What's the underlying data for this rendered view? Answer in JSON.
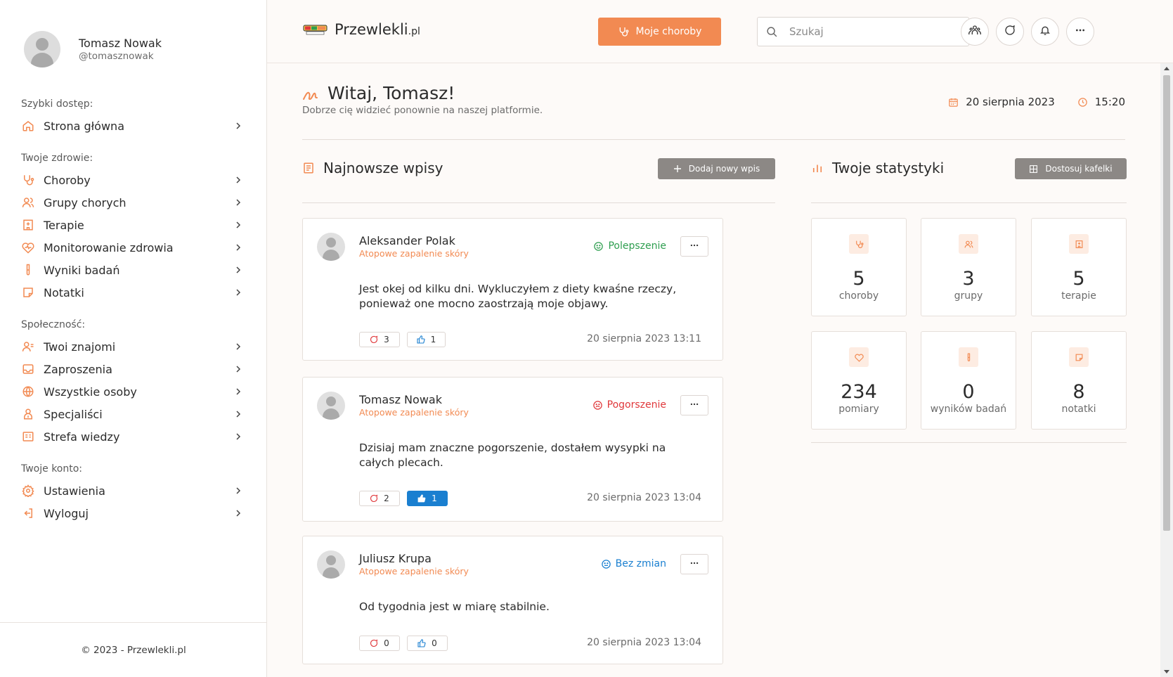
{
  "user": {
    "name": "Tomasz Nowak",
    "handle": "@tomasznowak"
  },
  "sidebar": {
    "quick_heading": "Szybki dostęp:",
    "quick": [
      {
        "label": "Strona główna",
        "icon": "home-icon"
      }
    ],
    "health_heading": "Twoje zdrowie:",
    "health": [
      {
        "label": "Choroby",
        "icon": "stethoscope-icon"
      },
      {
        "label": "Grupy chorych",
        "icon": "users-icon"
      },
      {
        "label": "Terapie",
        "icon": "hospital-icon"
      },
      {
        "label": "Monitorowanie zdrowia",
        "icon": "heart-pulse-icon"
      },
      {
        "label": "Wyniki badań",
        "icon": "test-tube-icon"
      },
      {
        "label": "Notatki",
        "icon": "note-icon"
      }
    ],
    "community_heading": "Społeczność:",
    "community": [
      {
        "label": "Twoi znajomi",
        "icon": "friends-icon"
      },
      {
        "label": "Zaproszenia",
        "icon": "inbox-icon"
      },
      {
        "label": "Wszystkie osoby",
        "icon": "globe-icon"
      },
      {
        "label": "Specjaliści",
        "icon": "specialist-icon"
      },
      {
        "label": "Strefa wiedzy",
        "icon": "knowledge-icon"
      }
    ],
    "account_heading": "Twoje konto:",
    "account": [
      {
        "label": "Ustawienia",
        "icon": "settings-icon"
      },
      {
        "label": "Wyloguj",
        "icon": "logout-icon"
      }
    ],
    "footer": "© 2023 - Przewlekli.pl"
  },
  "topbar": {
    "logo_main": "Przewlekli",
    "logo_suffix": ".pl",
    "primary_button": "Moje choroby",
    "search_placeholder": "Szukaj"
  },
  "welcome": {
    "title": "Witaj, Tomasz!",
    "subtitle": "Dobrze cię widzieć ponownie na naszej platformie.",
    "date": "20 sierpnia 2023",
    "time": "15:20"
  },
  "posts_section": {
    "title": "Najnowsze wpisy",
    "add_button": "Dodaj nowy wpis"
  },
  "stats_section": {
    "title": "Twoje statystyki",
    "customize_button": "Dostosuj kafelki"
  },
  "posts": [
    {
      "author": "Aleksander Polak",
      "condition": "Atopowe zapalenie skóry",
      "status": "Polepszenie",
      "status_color": "#2e9e4f",
      "text": "Jest okej od kilku dni. Wykluczyłem z diety kwaśne rzeczy, ponieważ one mocno zaostrzają moje objawy.",
      "comments": "3",
      "likes": "1",
      "liked": false,
      "date": "20 sierpnia 2023 13:11"
    },
    {
      "author": "Tomasz Nowak",
      "condition": "Atopowe zapalenie skóry",
      "status": "Pogorszenie",
      "status_color": "#e0383b",
      "text": "Dzisiaj mam znaczne pogorszenie, dostałem wysypki na całych plecach.",
      "comments": "2",
      "likes": "1",
      "liked": true,
      "date": "20 sierpnia 2023 13:04"
    },
    {
      "author": "Juliusz Krupa",
      "condition": "Atopowe zapalenie skóry",
      "status": "Bez zmian",
      "status_color": "#1a7fd0",
      "text": "Od tygodnia jest w miarę stabilnie.",
      "comments": "0",
      "likes": "0",
      "liked": false,
      "date": "20 sierpnia 2023 13:04"
    }
  ],
  "stats": [
    {
      "value": "5",
      "label": "choroby",
      "icon": "stethoscope-icon"
    },
    {
      "value": "3",
      "label": "grupy",
      "icon": "users-icon"
    },
    {
      "value": "5",
      "label": "terapie",
      "icon": "hospital-icon"
    },
    {
      "value": "234",
      "label": "pomiary",
      "icon": "heart-pulse-icon"
    },
    {
      "value": "0",
      "label": "wyników badań",
      "icon": "test-tube-icon"
    },
    {
      "value": "8",
      "label": "notatki",
      "icon": "note-icon"
    }
  ],
  "colors": {
    "accent": "#f28a52",
    "like_active": "#1a7fd0",
    "grey_button": "#8c8885"
  }
}
